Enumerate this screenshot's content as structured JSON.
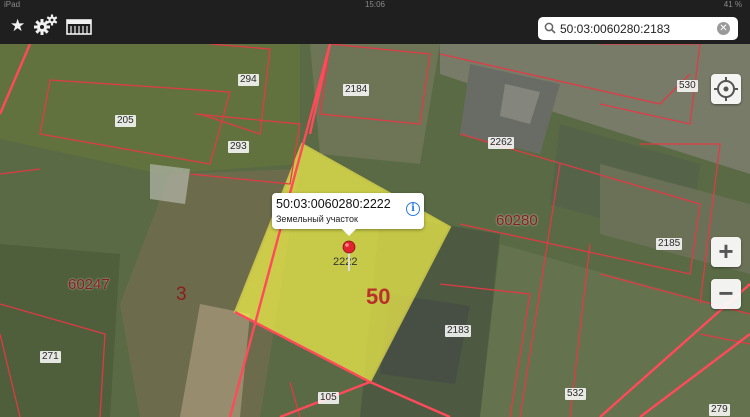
{
  "status_bar": {
    "carrier": "iPad",
    "time": "15:06",
    "battery": "41 %"
  },
  "toolbar": {
    "favorites_icon": "star-icon",
    "settings_icon": "gears-icon",
    "layers_icon": "layers-icon"
  },
  "search": {
    "value": "50:03:0060280:2183",
    "placeholder": ""
  },
  "popup": {
    "title": "50:03:0060280:2222",
    "subtitle": "Земельный участок"
  },
  "selected_parcel": {
    "label": "2222"
  },
  "map_labels": {
    "region": "50",
    "district": "3",
    "quarters": [
      "60280",
      "60247"
    ],
    "parcels": [
      "294",
      "205",
      "293",
      "2184",
      "530",
      "2262",
      "2185",
      "2183",
      "271",
      "105",
      "532",
      "279"
    ]
  },
  "controls": {
    "zoom_in": "+",
    "zoom_out": "−",
    "locate_icon": "crosshair-icon"
  },
  "colors": {
    "parcel_border": "#e63946",
    "selection_fill": "#f2f04a",
    "toolbar": "#1f1f1f"
  }
}
